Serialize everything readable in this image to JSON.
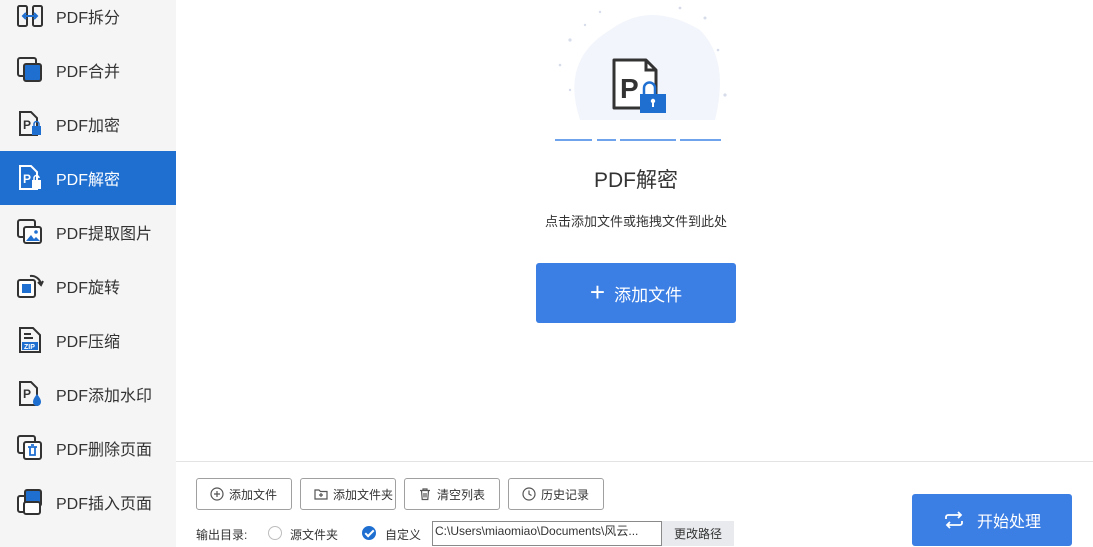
{
  "sidebar": {
    "items": [
      {
        "label": "PDF拆分",
        "icon": "split-icon"
      },
      {
        "label": "PDF合并",
        "icon": "merge-icon"
      },
      {
        "label": "PDF加密",
        "icon": "encrypt-icon"
      },
      {
        "label": "PDF解密",
        "icon": "decrypt-icon",
        "active": true
      },
      {
        "label": "PDF提取图片",
        "icon": "extract-image-icon"
      },
      {
        "label": "PDF旋转",
        "icon": "rotate-icon"
      },
      {
        "label": "PDF压缩",
        "icon": "zip-icon"
      },
      {
        "label": "PDF添加水印",
        "icon": "watermark-icon"
      },
      {
        "label": "PDF删除页面",
        "icon": "delete-page-icon"
      },
      {
        "label": "PDF插入页面",
        "icon": "insert-page-icon"
      }
    ]
  },
  "main": {
    "title": "PDF解密",
    "hint": "点击添加文件或拖拽文件到此处",
    "add_button": "添加文件"
  },
  "toolbar": {
    "add_file": "添加文件",
    "add_folder": "添加文件夹",
    "clear_list": "清空列表",
    "history": "历史记录"
  },
  "output": {
    "label": "输出目录:",
    "option_source": "源文件夹",
    "option_custom": "自定义",
    "path": "C:\\Users\\miaomiao\\Documents\\风云...",
    "change_path": "更改路径"
  },
  "start_button": "开始处理",
  "colors": {
    "accent": "#3b7ee4",
    "active_sidebar": "#1f6fd1",
    "sidebar_bg": "#f5f5f5"
  }
}
